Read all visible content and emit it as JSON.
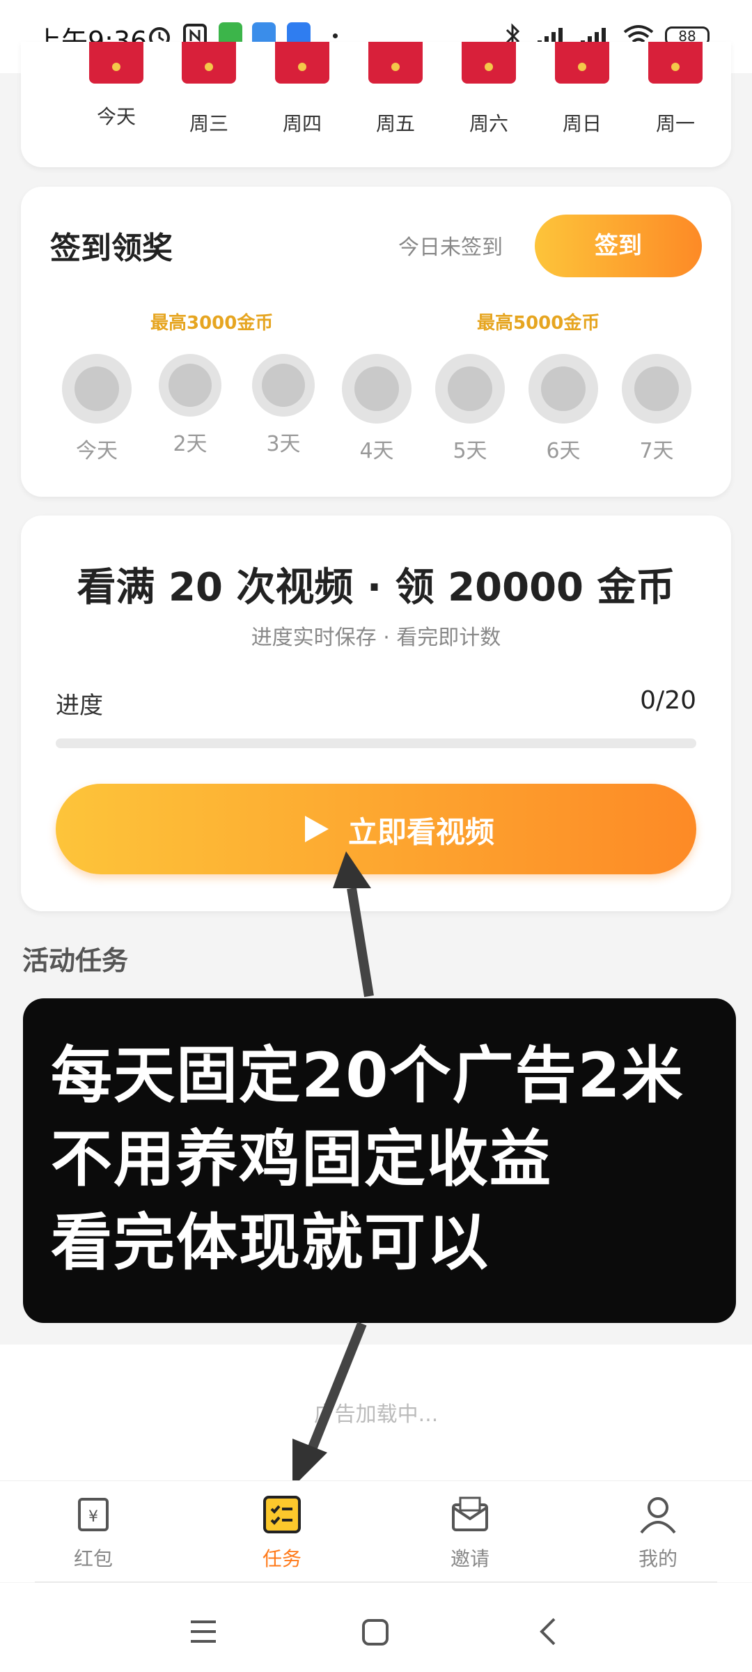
{
  "status_bar": {
    "time": "上午9:36",
    "battery": "88"
  },
  "week_row": {
    "days": [
      "今天",
      "周三",
      "周四",
      "周五",
      "周六",
      "周日",
      "周一"
    ]
  },
  "signin": {
    "title": "签到领奖",
    "status": "今日未签到",
    "button": "签到",
    "max_labels": [
      "最高3000金币",
      "最高5000金币"
    ],
    "days": [
      "今天",
      "2天",
      "3天",
      "4天",
      "5天",
      "6天",
      "7天"
    ]
  },
  "video_task": {
    "title": "看满 20 次视频 · 领 20000 金币",
    "subtitle": "进度实时保存 · 看完即计数",
    "progress_label": "进度",
    "progress_count": "0/20",
    "progress_fraction": 0,
    "button": "立即看视频"
  },
  "activity": {
    "title": "活动任务"
  },
  "annotation": {
    "lines": [
      "每天固定20个广告2米",
      "不用养鸡固定收益",
      "看完体现就可以"
    ]
  },
  "ad": {
    "loading": "广告加载中..."
  },
  "bottom_nav": {
    "items": [
      {
        "label": "红包",
        "icon": "red-envelope-icon"
      },
      {
        "label": "任务",
        "icon": "task-list-icon"
      },
      {
        "label": "邀请",
        "icon": "mail-icon"
      },
      {
        "label": "我的",
        "icon": "person-icon"
      }
    ],
    "active": "任务"
  },
  "colors": {
    "accent_start": "#fdc43a",
    "accent_end": "#fd8a26",
    "red_envelope": "#d8203a",
    "active_nav": "#ff7a1a"
  }
}
